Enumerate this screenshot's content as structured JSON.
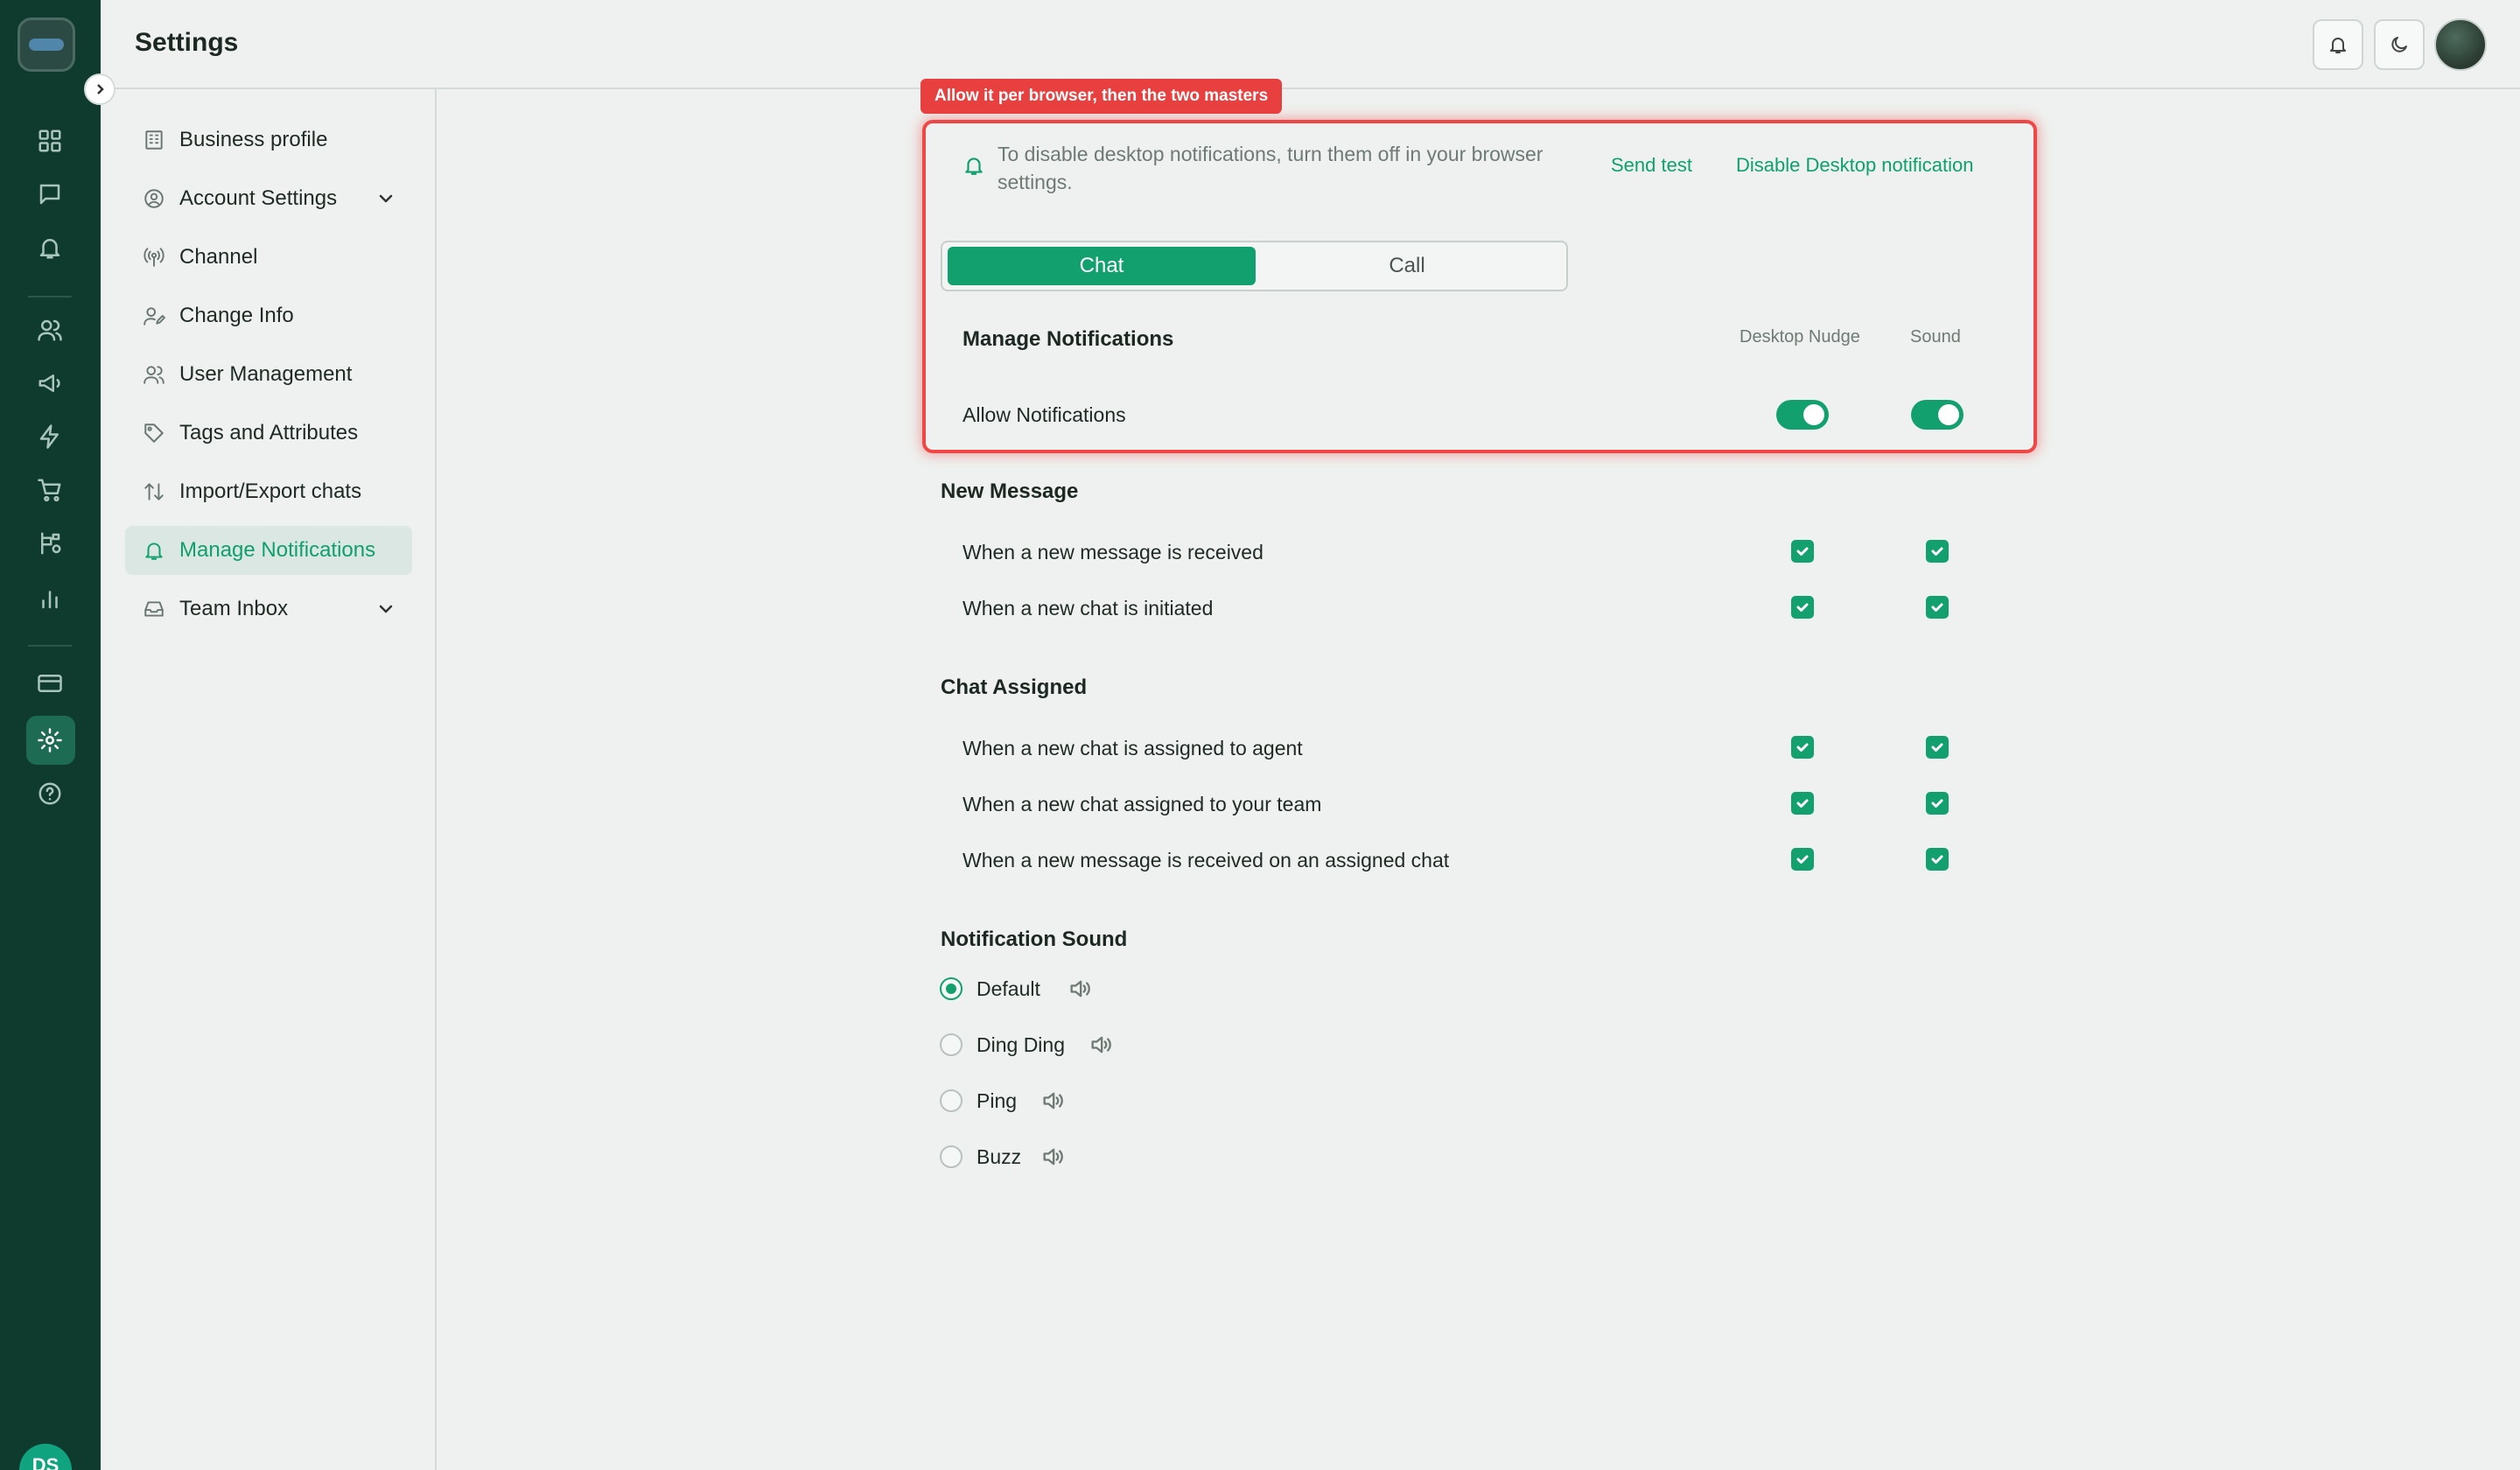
{
  "header": {
    "title": "Settings"
  },
  "rail": {
    "avatar_initials": "DS"
  },
  "sidebar": {
    "items": [
      {
        "label": "Business profile",
        "icon": "building-icon"
      },
      {
        "label": "Account Settings",
        "icon": "user-circle-icon"
      },
      {
        "label": "Channel",
        "icon": "broadcast-icon"
      },
      {
        "label": "Change Info",
        "icon": "user-edit-icon"
      },
      {
        "label": "User Management",
        "icon": "users-icon"
      },
      {
        "label": "Tags and Attributes",
        "icon": "tag-icon"
      },
      {
        "label": "Import/Export chats",
        "icon": "arrows-updown-icon"
      },
      {
        "label": "Manage Notifications",
        "icon": "bell-icon",
        "active": true
      },
      {
        "label": "Team Inbox",
        "icon": "inbox-icon"
      }
    ]
  },
  "main": {
    "annotation_badge": "Allow it per browser, then the two masters",
    "info_text": "To disable desktop notifications, turn them off in your browser settings.",
    "send_test_label": "Send test",
    "disable_desktop_label": "Disable Desktop notification",
    "tabs": [
      {
        "label": "Chat",
        "selected": true
      },
      {
        "label": "Call",
        "selected": false
      }
    ],
    "manage_title": "Manage Notifications",
    "col_desktop": "Desktop Nudge",
    "col_sound": "Sound",
    "allow_label": "Allow Notifications",
    "allow_desktop_on": true,
    "allow_sound_on": true,
    "sections": {
      "new_message": {
        "title": "New Message",
        "rows": [
          {
            "label": "When a new message is received",
            "desktop": true,
            "sound": true
          },
          {
            "label": "When a new chat is initiated",
            "desktop": true,
            "sound": true
          }
        ]
      },
      "chat_assigned": {
        "title": "Chat Assigned",
        "rows": [
          {
            "label": "When a new chat is assigned to agent",
            "desktop": true,
            "sound": true
          },
          {
            "label": "When a new chat assigned to your team",
            "desktop": true,
            "sound": true
          },
          {
            "label": "When a new message is received on an assigned chat",
            "desktop": true,
            "sound": true
          }
        ]
      }
    },
    "sound": {
      "title": "Notification Sound",
      "options": [
        {
          "label": "Default",
          "selected": true
        },
        {
          "label": "Ding Ding",
          "selected": false
        },
        {
          "label": "Ping",
          "selected": false
        },
        {
          "label": "Buzz",
          "selected": false
        }
      ]
    }
  },
  "colors": {
    "accent": "#13a06f",
    "rail_bg": "#0f3b2f",
    "highlight_red": "#ef4746"
  }
}
